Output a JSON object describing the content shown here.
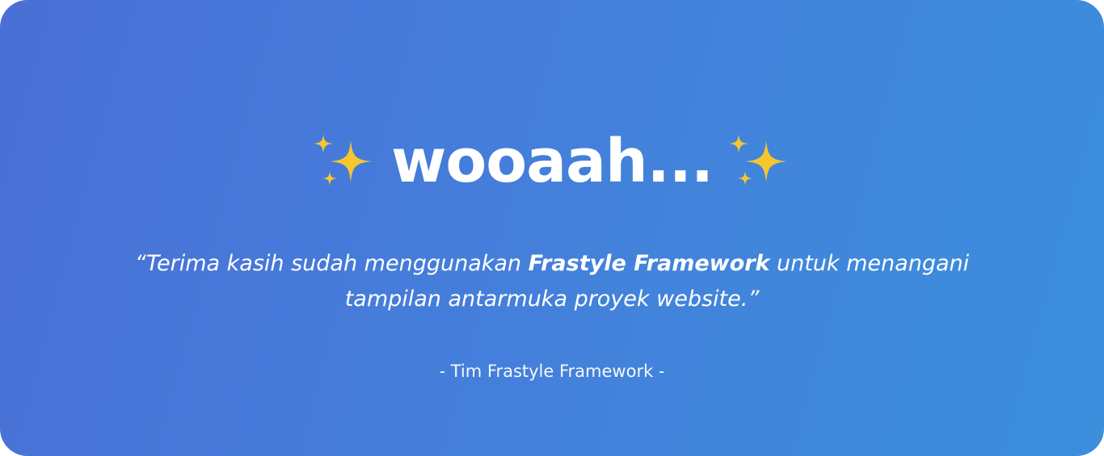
{
  "headline": {
    "text": "wooaah...",
    "left_icon": "sparkles-icon",
    "right_icon": "sparkles-icon"
  },
  "quote": {
    "part1": "“Terima kasih sudah menggunakan ",
    "emphasis": "Frastyle Framework",
    "part2": " untuk menangani tampilan antarmuka proyek website.”"
  },
  "signature": "- Tim Frastyle Framework -",
  "colors": {
    "gradient_start": "#4a6fd6",
    "gradient_end": "#3b8fdc",
    "text": "#ffffff",
    "sparkle": "#f7c62f"
  }
}
